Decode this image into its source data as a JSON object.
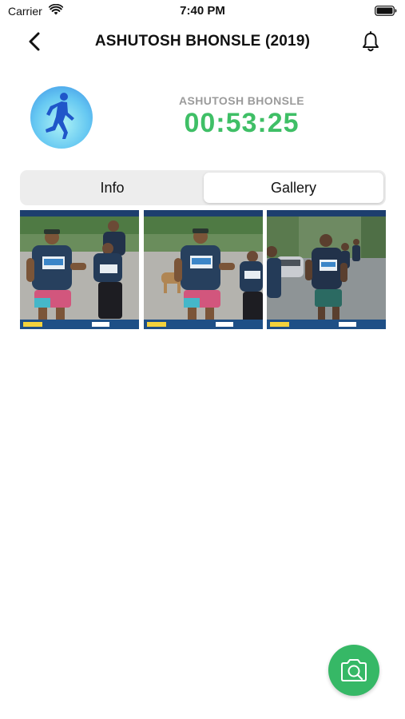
{
  "status_bar": {
    "carrier": "Carrier",
    "time": "7:40 PM",
    "icons": [
      "wifi-icon",
      "battery-icon"
    ]
  },
  "nav": {
    "title": "ASHUTOSH BHONSLE (2019)",
    "back_icon": "chevron-left-icon",
    "notification_icon": "bell-icon"
  },
  "profile": {
    "avatar_icon": "runner-icon",
    "name": "ASHUTOSH BHONSLE",
    "finish_time": "00:53:25",
    "time_color": "#3fbf66"
  },
  "tabs": [
    {
      "label": "Info",
      "selected": false
    },
    {
      "label": "Gallery",
      "selected": true
    }
  ],
  "gallery": {
    "photos": [
      {
        "description": "runner-photo"
      },
      {
        "description": "runner-photo"
      },
      {
        "description": "runner-photo"
      }
    ]
  },
  "fab": {
    "icon": "camera-icon",
    "color": "#36b866"
  }
}
